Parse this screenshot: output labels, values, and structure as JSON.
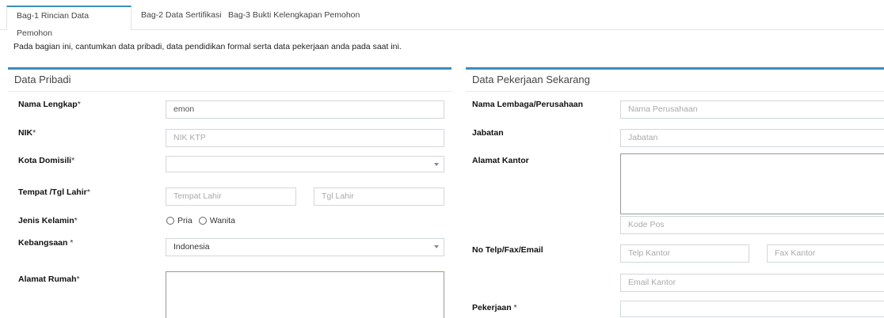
{
  "tabs": [
    {
      "label": "Bag-1 Rincian Data Pemohon",
      "active": true
    },
    {
      "label": "Bag-2 Data Sertifikasi",
      "active": false
    },
    {
      "label": "Bag-3 Bukti Kelengkapan Pemohon",
      "active": false
    }
  ],
  "intro": "Pada bagian ini, cantumkan data pribadi, data pendidikan formal serta data pekerjaan anda pada saat ini.",
  "left": {
    "title": "Data Pribadi",
    "nama": {
      "label": "Nama Lengkap",
      "value": "emon"
    },
    "nik": {
      "label": "NIK",
      "placeholder": "NIK KTP"
    },
    "kota": {
      "label": "Kota Domisili",
      "value": ""
    },
    "ttl": {
      "label": "Tempat /Tgl Lahir",
      "tempat_placeholder": "Tempat Lahir",
      "tgl_placeholder": "Tgl Lahir"
    },
    "kelamin": {
      "label": "Jenis Kelamin",
      "options": [
        "Pria",
        "Wanita"
      ]
    },
    "kebangsaan": {
      "label": "Kebangsaan ",
      "value": "Indonesia"
    },
    "alamat": {
      "label": "Alamat Rumah"
    },
    "required_mark": "*"
  },
  "right": {
    "title": "Data Pekerjaan Sekarang",
    "lembaga": {
      "label": "Nama Lembaga/Perusahaan",
      "placeholder": "Nama Perusahaan"
    },
    "jabatan": {
      "label": "Jabatan",
      "placeholder": "Jabatan"
    },
    "alamat": {
      "label": "Alamat Kantor",
      "kodepos_placeholder": "Kode Pos"
    },
    "telp": {
      "label": "No Telp/Fax/Email",
      "telp_placeholder": "Telp Kantor",
      "fax_placeholder": "Fax Kantor",
      "email_placeholder": "Email Kantor"
    },
    "pekerjaan": {
      "label": "Pekerjaan ",
      "required_mark": "*"
    }
  },
  "colors": {
    "accent": "#3c8dbc"
  }
}
